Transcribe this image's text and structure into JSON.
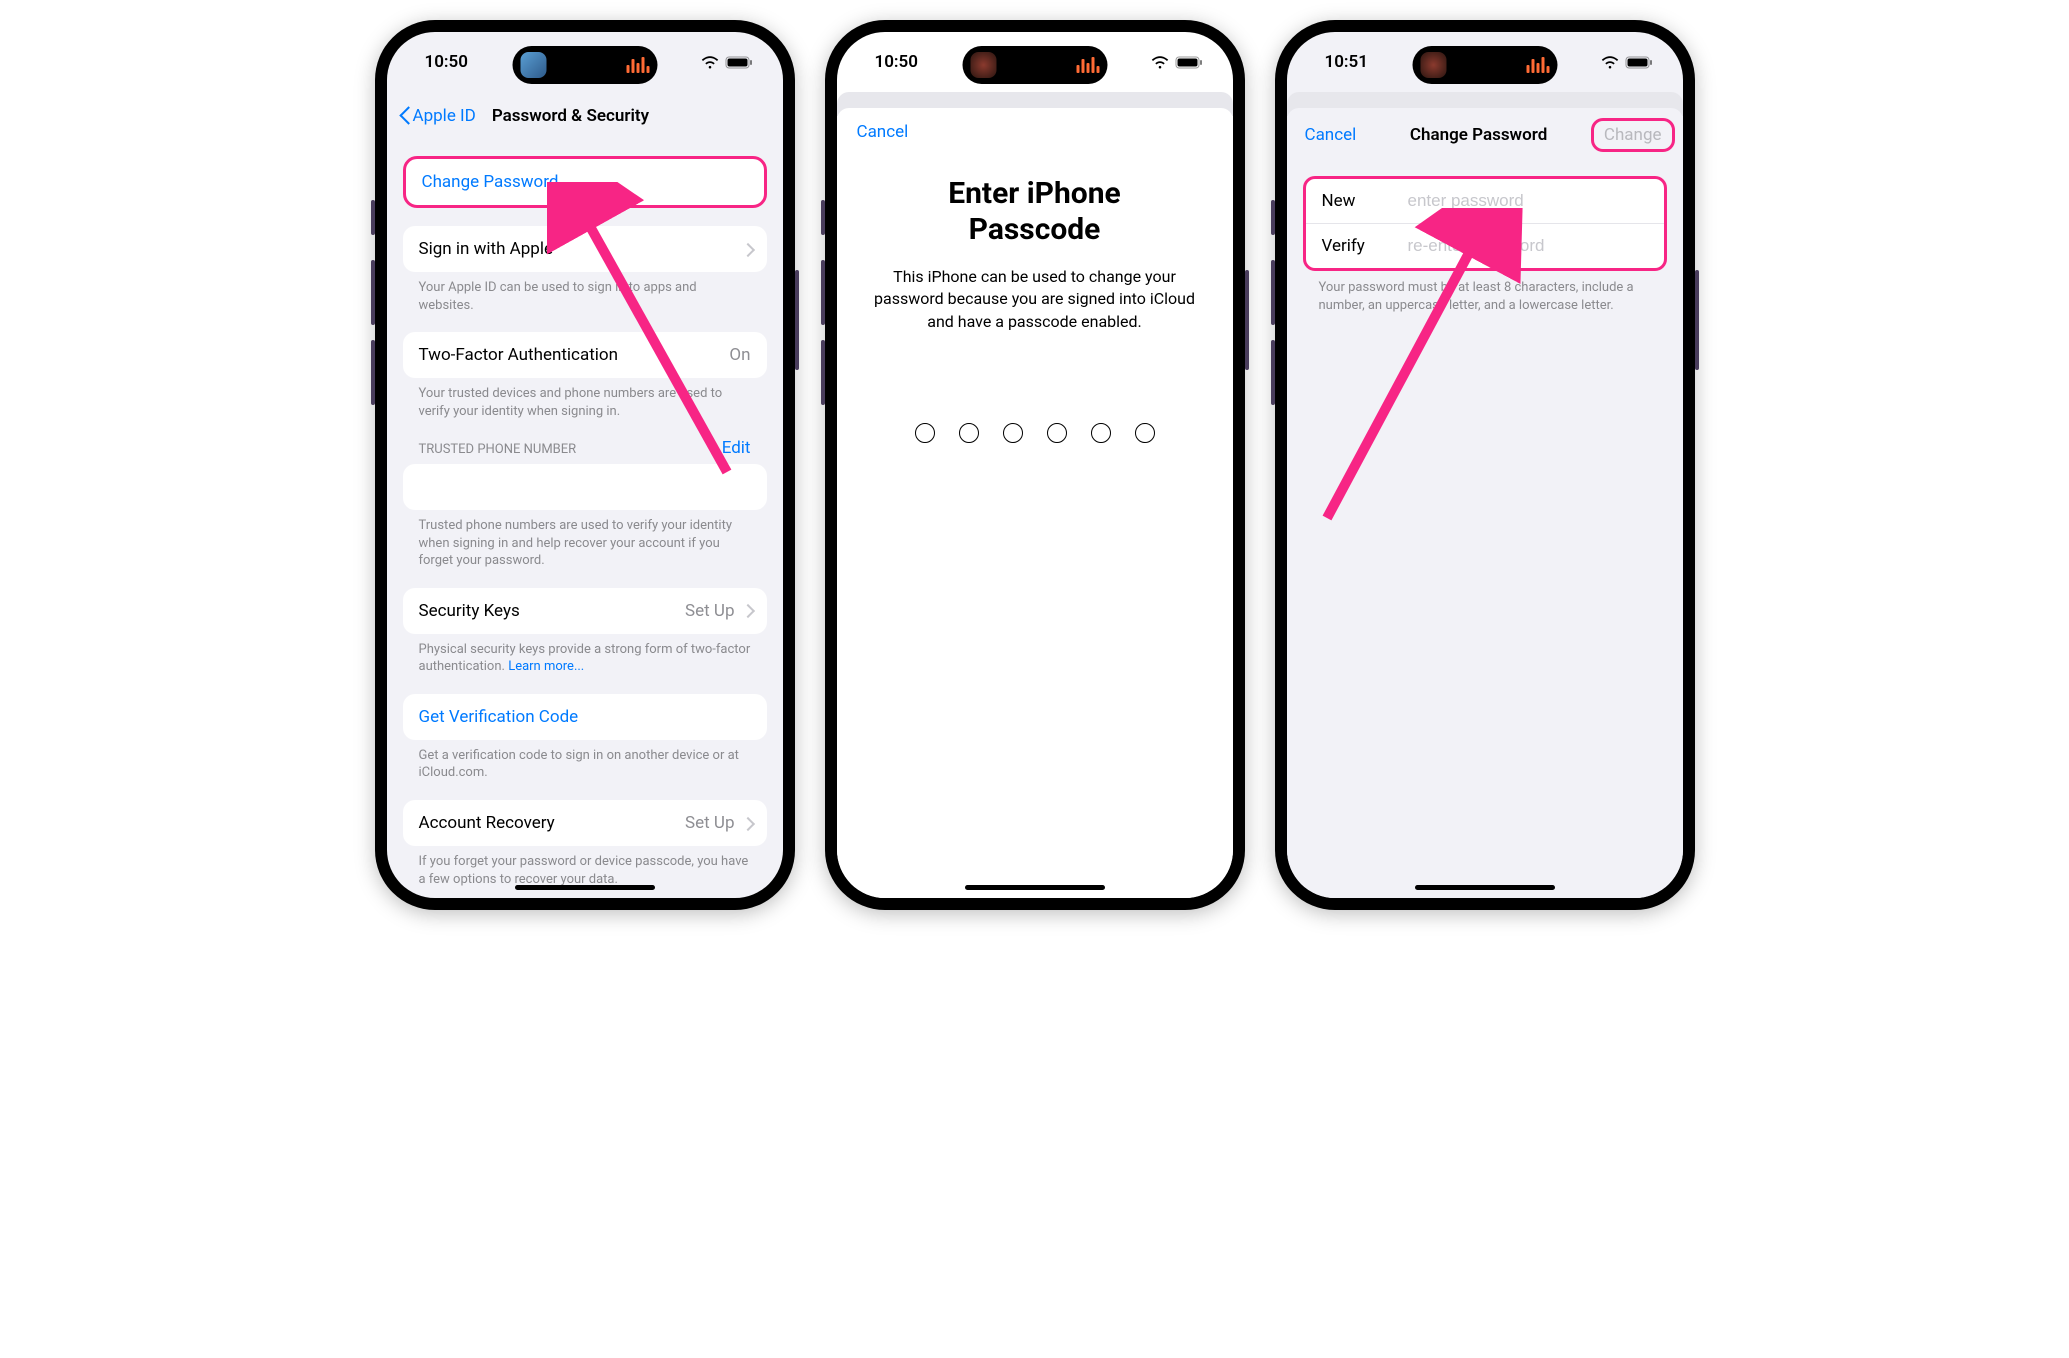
{
  "screen1": {
    "time": "10:50",
    "back_label": "Apple ID",
    "title": "Password & Security",
    "change_password": "Change Password",
    "signin_apple": "Sign in with Apple",
    "signin_footer": "Your Apple ID can be used to sign in to apps and websites.",
    "twofa_label": "Two-Factor Authentication",
    "twofa_value": "On",
    "twofa_footer": "Your trusted devices and phone numbers are used to verify your identity when signing in.",
    "trusted_header": "TRUSTED PHONE NUMBER",
    "edit": "Edit",
    "trusted_footer": "Trusted phone numbers are used to verify your identity when signing in and help recover your account if you forget your password.",
    "security_keys": "Security Keys",
    "security_keys_value": "Set Up",
    "security_keys_footer_pre": "Physical security keys provide a strong form of two-factor authentication. ",
    "security_keys_footer_link": "Learn more...",
    "get_code": "Get Verification Code",
    "get_code_footer": "Get a verification code to sign in on another device or at iCloud.com.",
    "account_recovery": "Account Recovery",
    "account_recovery_value": "Set Up",
    "account_recovery_footer": "If you forget your password or device passcode, you have a few options to recover your data."
  },
  "screen2": {
    "time": "10:50",
    "cancel": "Cancel",
    "title_line1": "Enter iPhone",
    "title_line2": "Passcode",
    "desc": "This iPhone can be used to change your password because you are signed into iCloud and have a passcode enabled."
  },
  "screen3": {
    "time": "10:51",
    "cancel": "Cancel",
    "title": "Change Password",
    "change": "Change",
    "new_label": "New",
    "new_placeholder": "enter password",
    "verify_label": "Verify",
    "verify_placeholder": "re-enter password",
    "footer": "Your password must be at least 8 characters, include a number, an uppercase letter, and a lowercase letter."
  }
}
